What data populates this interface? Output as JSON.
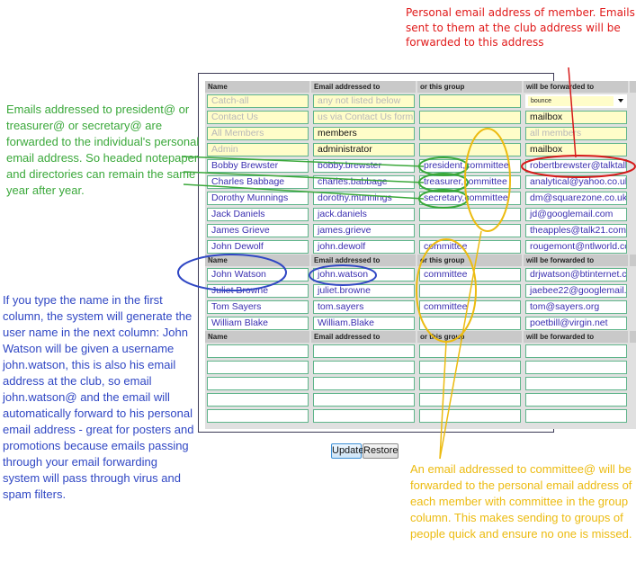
{
  "table": {
    "headers": [
      "Name",
      "Email addressed to",
      "or this group",
      "will be forwarded to"
    ],
    "system_rows": [
      {
        "name": "Catch-all",
        "email": "any not listed below",
        "group": "",
        "forward_select": "bounce"
      },
      {
        "name": "Contact Us",
        "email": "us via Contact Us form",
        "group": "",
        "forward": "mailbox"
      },
      {
        "name": "All Members",
        "email": "members",
        "group": "",
        "forward": "all members"
      },
      {
        "name": "Admin",
        "email": "administrator",
        "group": "",
        "forward": "mailbox"
      }
    ],
    "member_rows_1": [
      {
        "name": "Bobby Brewster",
        "email": "bobby.brewster",
        "group": "president,committee",
        "forward": "robertbrewster@talktalk"
      },
      {
        "name": "Charles Babbage",
        "email": "charles.babbage",
        "group": "treasurer,committee",
        "forward": "analytical@yahoo.co.uk"
      },
      {
        "name": "Dorothy Munnings",
        "email": "dorothy.munnings",
        "group": "secretary,committee",
        "forward": "dm@squarezone.co.uk"
      },
      {
        "name": "Jack Daniels",
        "email": "jack.daniels",
        "group": "",
        "forward": "jd@googlemail.com"
      },
      {
        "name": "James Grieve",
        "email": "james.grieve",
        "group": "",
        "forward": "theapples@talk21.com"
      },
      {
        "name": "John Dewolf",
        "email": "john.dewolf",
        "group": "committee",
        "forward": "rougemont@ntlworld.co"
      }
    ],
    "member_rows_2": [
      {
        "name": "John Watson",
        "email": "john.watson",
        "group": "committee",
        "forward": "drjwatson@btinternet.co"
      },
      {
        "name": "Juliet Browne",
        "email": "juliet.browne",
        "group": "",
        "forward": "jaebee22@googlemail."
      },
      {
        "name": "Tom Sayers",
        "email": "tom.sayers",
        "group": "committee",
        "forward": "tom@sayers.org"
      },
      {
        "name": "William Blake",
        "email": "William.Blake",
        "group": "",
        "forward": "poetbill@virgin.net"
      }
    ],
    "empty_rows": 5
  },
  "buttons": {
    "update": "Update",
    "restore": "Restore"
  },
  "annotations": {
    "red": "Personal email address of member. Emails sent to them at the club address will be forwarded to this address",
    "green": "Emails addressed to president@ or treasurer@ or secretary@ are forwarded to the individual's personal email address. So headed notepaper and directories can remain the same year after year.",
    "blue": "If you type the name in the first column, the system will generate the user name in the next column: John Watson will be given a username john.watson, this is also his email address at the club, so email john.watson@ and the email will automatically forward to his personal email address - great for posters and promotions because emails passing through your email forwarding system will pass through virus and spam filters.",
    "orange": "An email addressed to committee@ will be forwarded to the personal email address of each member with committee in the group column.  This makes sending to groups of people quick and ensure no one is missed."
  },
  "colors": {
    "red": "#e01818",
    "green": "#3aa83a",
    "blue": "#3047c4",
    "orange": "#ecbb10",
    "input_border": "#5fb58b",
    "system_fill": "#fffdc9",
    "member_text": "#3a2fb0"
  }
}
